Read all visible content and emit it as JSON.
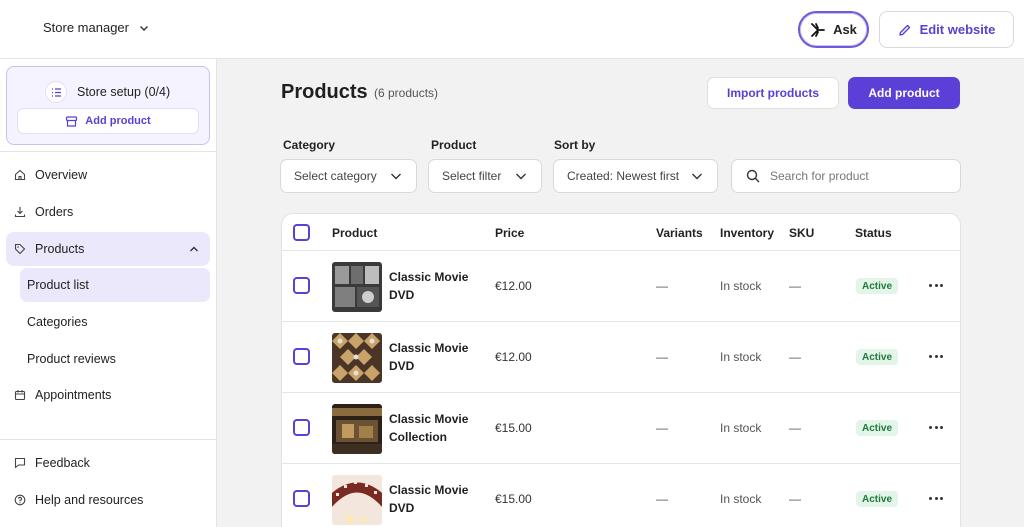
{
  "topbar": {
    "store_name": "Store manager",
    "ask_label": "Ask",
    "edit_label": "Edit website"
  },
  "sidebar": {
    "setup_label": "Store setup (0/4)",
    "setup_add_label": "Add product",
    "items": [
      {
        "label": "Overview",
        "icon": "home-icon"
      },
      {
        "label": "Orders",
        "icon": "download-icon"
      },
      {
        "label": "Products",
        "icon": "tag-icon"
      },
      {
        "label": "Appointments",
        "icon": "calendar-icon"
      },
      {
        "label": "Feedback",
        "icon": "chat-icon"
      },
      {
        "label": "Help and resources",
        "icon": "help-icon"
      }
    ],
    "sub_items": [
      "Product list",
      "Categories",
      "Product reviews"
    ]
  },
  "main": {
    "title": "Products",
    "count": "(6 products)",
    "import_label": "Import products",
    "add_label": "Add product"
  },
  "filters": {
    "category_label": "Category",
    "category_value": "Select category",
    "product_label": "Product",
    "product_value": "Select filter",
    "sort_label": "Sort by",
    "sort_value": "Created: Newest first",
    "search_placeholder": "Search for product"
  },
  "table": {
    "headers": [
      "Product",
      "Price",
      "Variants",
      "Inventory",
      "SKU",
      "Status"
    ],
    "rows": [
      {
        "name": "Classic Movie DVD",
        "price": "€12.00",
        "variants": "—",
        "inventory": "In stock",
        "sku": "—",
        "status": "Active"
      },
      {
        "name": "Classic Movie DVD",
        "price": "€12.00",
        "variants": "—",
        "inventory": "In stock",
        "sku": "—",
        "status": "Active"
      },
      {
        "name": "Classic Movie Collection",
        "price": "€15.00",
        "variants": "—",
        "inventory": "In stock",
        "sku": "—",
        "status": "Active"
      },
      {
        "name": "Classic Movie DVD",
        "price": "€15.00",
        "variants": "—",
        "inventory": "In stock",
        "sku": "—",
        "status": "Active"
      }
    ]
  },
  "colors": {
    "accent": "#5b3fd6",
    "active_nav_bg": "#ece8fb",
    "status_bg": "#e3f5e8",
    "status_text": "#1e7a3c"
  }
}
